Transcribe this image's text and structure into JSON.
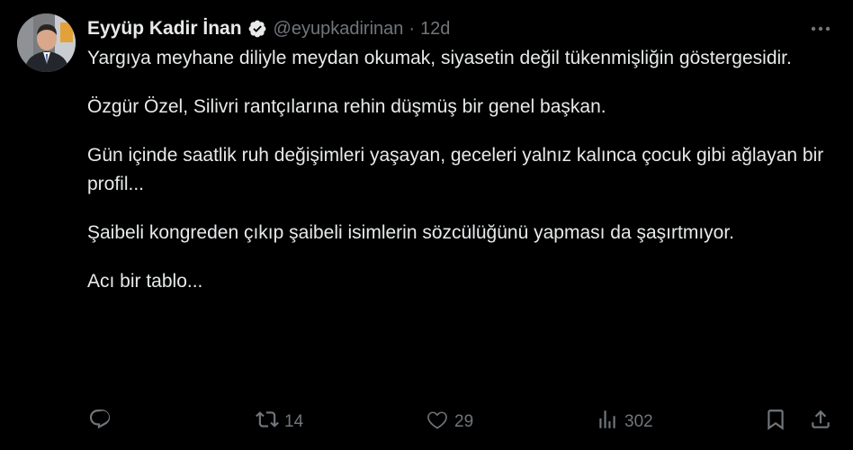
{
  "author": {
    "display_name": "Eyyüp Kadir İnan",
    "handle": "@eyupkadirinan",
    "separator": "·",
    "time": "12d",
    "verified": true
  },
  "tweet": {
    "paragraphs": [
      "Yargıya meyhane diliyle meydan okumak, siyasetin değil tükenmişliğin göstergesidir.",
      "Özgür Özel, Silivri rantçılarına rehin düşmüş bir genel başkan.",
      "Gün içinde saatlik ruh değişimleri yaşayan, geceleri yalnız kalınca çocuk gibi ağlayan bir profil...",
      "Şaibeli kongreden çıkıp şaibeli isimlerin sözcülüğünü yapması da şaşırtmıyor.",
      "Acı bir tablo..."
    ]
  },
  "actions": {
    "replies": "",
    "retweets": "14",
    "likes": "29",
    "views": "302"
  },
  "icons": {
    "verified": "verified-badge-icon",
    "more": "more-options-icon",
    "reply": "reply-icon",
    "retweet": "retweet-icon",
    "like": "heart-icon",
    "views": "views-chart-icon",
    "bookmark": "bookmark-icon",
    "share": "share-icon"
  },
  "colors": {
    "background": "#000000",
    "text": "#e7e9ea",
    "muted": "#71767b"
  }
}
